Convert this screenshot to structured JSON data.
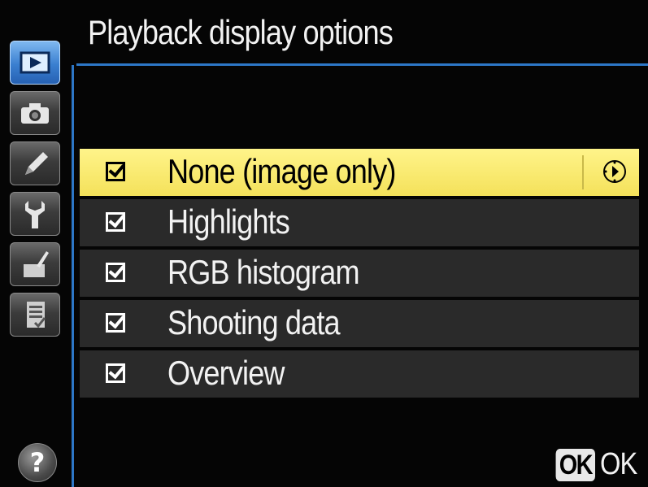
{
  "header": {
    "title": "Playback display options"
  },
  "tabs": [
    {
      "name": "playback-menu",
      "icon": "playback-icon",
      "active": true
    },
    {
      "name": "shooting-menu",
      "icon": "camera-icon",
      "active": false
    },
    {
      "name": "custom-settings-menu",
      "icon": "pencil-icon",
      "active": false
    },
    {
      "name": "setup-menu",
      "icon": "wrench-icon",
      "active": false
    },
    {
      "name": "retouch-menu",
      "icon": "retouch-brush-icon",
      "active": false
    },
    {
      "name": "my-menu",
      "icon": "my-menu-list-icon",
      "active": false
    }
  ],
  "options": [
    {
      "label": "None (image only)",
      "checked": true,
      "selected": true
    },
    {
      "label": "Highlights",
      "checked": true,
      "selected": false
    },
    {
      "label": "RGB histogram",
      "checked": true,
      "selected": false
    },
    {
      "label": "Shooting data",
      "checked": true,
      "selected": false
    },
    {
      "label": "Overview",
      "checked": true,
      "selected": false
    }
  ],
  "footer": {
    "ok_badge": "OK",
    "ok_label": "OK",
    "help_symbol": "?"
  },
  "colors": {
    "accent_blue": "#2d77c7",
    "highlight_yellow": "#f4e15a",
    "row_background": "#2a2a2a"
  }
}
